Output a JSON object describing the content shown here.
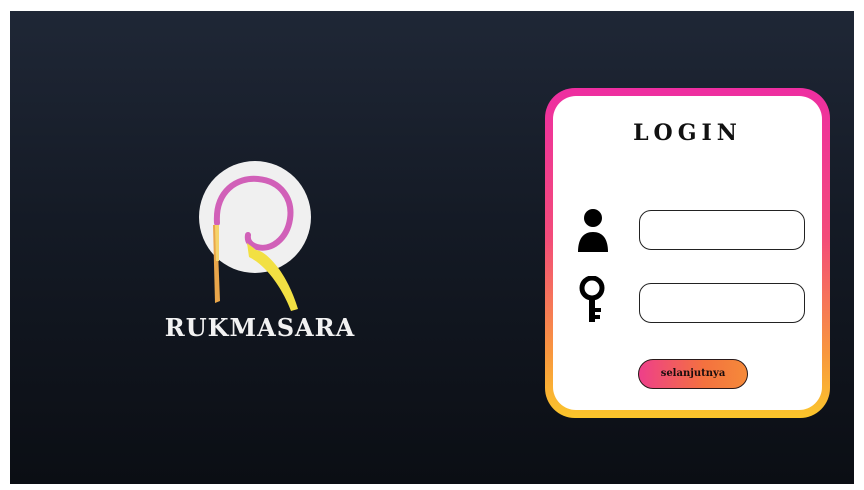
{
  "brand": {
    "name": "RUKMASARA",
    "logo_icon": "r-letter-logo"
  },
  "login": {
    "title": "LOGIN",
    "username": {
      "icon": "user-icon",
      "value": "",
      "placeholder": ""
    },
    "password": {
      "icon": "key-icon",
      "value": "",
      "placeholder": ""
    },
    "next_button_label": "selanjutnya"
  },
  "colors": {
    "background_top": "#1f2736",
    "background_bottom": "#0b0e14",
    "card_border_top": "#ee2ea1",
    "card_border_bottom": "#fbc52b",
    "logo_pink": "#d160b8",
    "logo_yellow": "#f2e043",
    "logo_orange": "#e9a64a"
  }
}
